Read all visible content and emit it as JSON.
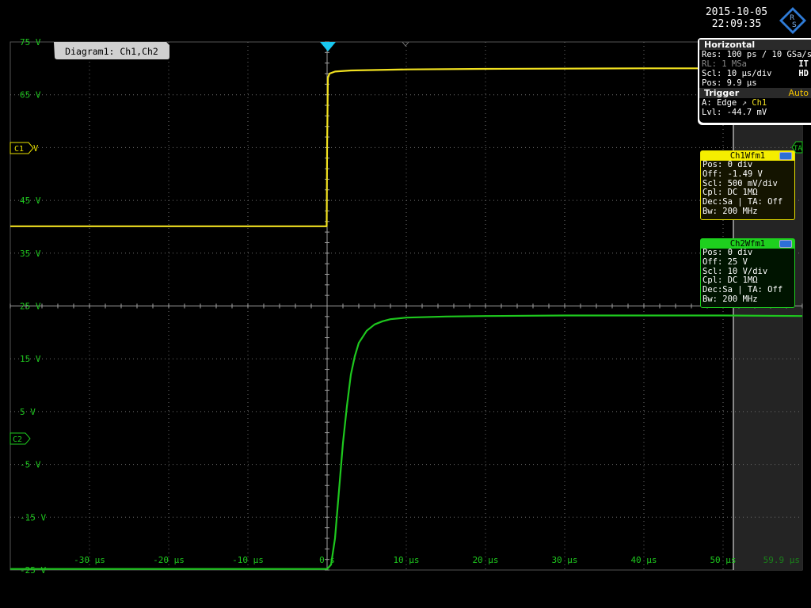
{
  "header": {
    "date": "2015-10-05",
    "time": "22:09:35",
    "logo_text": "RS"
  },
  "diagram": {
    "label": "Diagram1: Ch1,Ch2"
  },
  "horizontal": {
    "title": "Horizontal",
    "res": "Res: 100 ps / 10 GSa/s",
    "rl": "RL:  1 MSa",
    "rl_flag": "IT",
    "scl": "Scl:  10 μs/div",
    "scl_flag": "HD",
    "pos": "Pos:  9.9 μs"
  },
  "trigger": {
    "title": "Trigger",
    "mode": "Auto",
    "source_line": "A:   Edge",
    "source": "Ch1",
    "level": "Lvl:  -44.7 mV"
  },
  "ch1": {
    "title": "Ch1Wfm1",
    "lines": [
      "Pos: 0 div",
      "Off: -1.49 V",
      "Scl: 500 mV/div",
      "Cpl: DC 1MΩ",
      "Dec:Sa | TA: Off",
      "Bw: 200 MHz"
    ]
  },
  "ch2": {
    "title": "Ch2Wfm1",
    "lines": [
      "Pos: 0 div",
      "Off: 25 V",
      "Scl: 10 V/div",
      "Cpl: DC 1MΩ",
      "Dec:Sa | TA: Off",
      "Bw: 200 MHz"
    ]
  },
  "markers": {
    "c1": "C1",
    "c1_suffix": "V",
    "c2": "C2",
    "ta": "TA"
  },
  "colors": {
    "ch1": "#f0e020",
    "ch2": "#1ec81e",
    "grid": "#707070",
    "trigger": "#19c8f0"
  },
  "chart_data": {
    "type": "line",
    "title": "Diagram1: Ch1,Ch2",
    "x_unit": "μs",
    "xlim": [
      -40,
      60
    ],
    "ylim": [
      -25,
      75
    ],
    "grid": true,
    "x_ticks": [
      -30,
      -20,
      -10,
      0,
      10,
      20,
      30,
      40,
      50
    ],
    "x_tick_labels": [
      "-30 μs",
      "-20 μs",
      "-10 μs",
      "0 s",
      "10 μs",
      "20 μs",
      "30 μs",
      "40 μs",
      "50 μs"
    ],
    "x_end_label": "59.9 μs",
    "y_ticks": [
      75,
      65,
      55,
      45,
      35,
      25,
      15,
      5,
      -5,
      -15,
      -25
    ],
    "y_tick_labels": [
      "75 V",
      "65 V",
      "",
      "45 V",
      "35 V",
      "25 V",
      "15 V",
      "5 V",
      "-5 V",
      "-15 V",
      "-25 V"
    ],
    "series": [
      {
        "name": "Ch1",
        "color": "#f0e020",
        "x": [
          -40,
          -0.05,
          0,
          0.1,
          0.3,
          1,
          3,
          10,
          20,
          40,
          60
        ],
        "y": [
          40.1,
          40.1,
          55,
          68.2,
          69.0,
          69.4,
          69.6,
          69.8,
          69.9,
          70,
          70
        ]
      },
      {
        "name": "Ch2",
        "color": "#1ec81e",
        "x": [
          -40,
          0,
          0.5,
          1,
          1.5,
          2,
          2.5,
          3,
          3.5,
          4,
          5,
          6,
          7,
          8,
          10,
          15,
          20,
          30,
          40,
          50,
          60
        ],
        "y": [
          -24.8,
          -24.8,
          -24,
          -19,
          -10,
          -1,
          6,
          12,
          15.5,
          18,
          20.3,
          21.5,
          22.1,
          22.5,
          22.8,
          23.0,
          23.1,
          23.2,
          23.2,
          23.2,
          23.1
        ]
      }
    ]
  }
}
